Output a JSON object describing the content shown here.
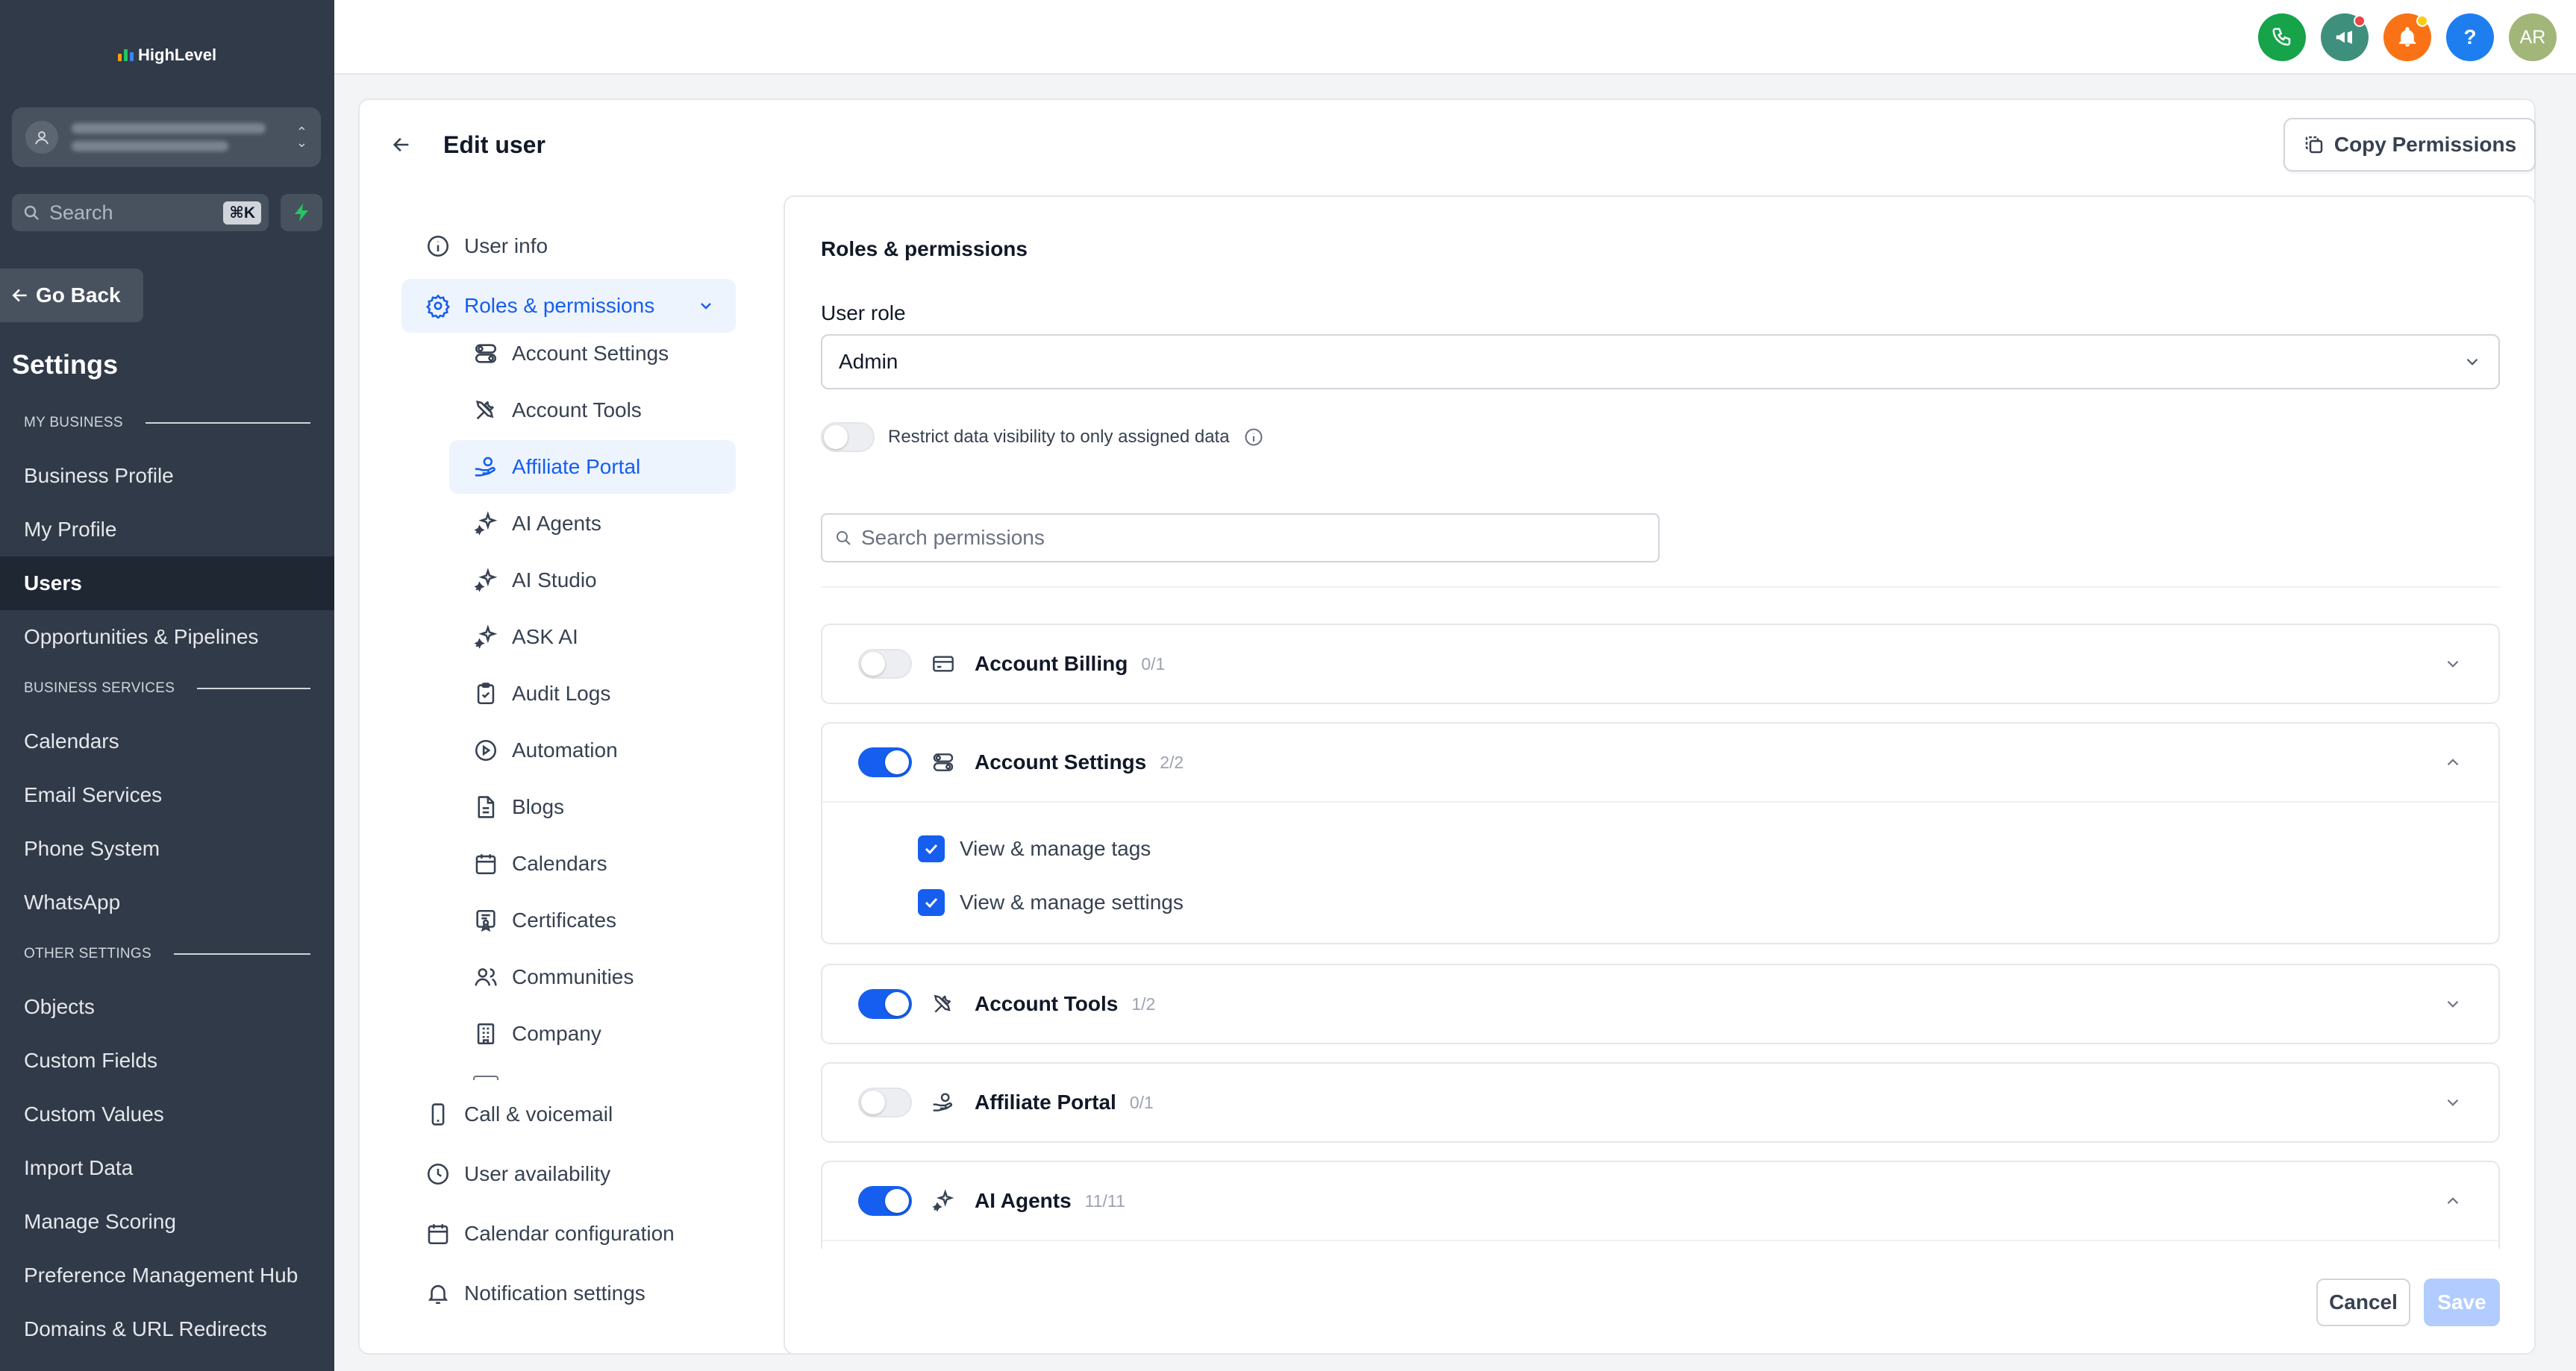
{
  "brand": {
    "name": "HighLevel"
  },
  "sidebar": {
    "search_placeholder": "Search",
    "search_shortcut": "⌘K",
    "go_back": "Go Back",
    "settings_title": "Settings",
    "sections": {
      "my_business": "MY BUSINESS",
      "business_services": "BUSINESS SERVICES",
      "other_settings": "OTHER SETTINGS"
    },
    "items": [
      "Business Profile",
      "My Profile",
      "Users",
      "Opportunities & Pipelines",
      "Calendars",
      "Email Services",
      "Phone System",
      "WhatsApp",
      "Objects",
      "Custom Fields",
      "Custom Values",
      "Import Data",
      "Manage Scoring",
      "Preference Management Hub",
      "Domains & URL Redirects"
    ],
    "active_item": "Users"
  },
  "topbar": {
    "avatar_initials": "AR",
    "help_label": "?",
    "colors": {
      "phone": "#16a34a",
      "announce": "#3f8f7d",
      "notify": "#f97316",
      "help": "#1e7ef0",
      "avatar": "#a3b67a",
      "badge": "#ef4444"
    }
  },
  "page": {
    "title": "Edit user",
    "copy_permissions": "Copy Permissions"
  },
  "subnav": {
    "user_info": "User info",
    "roles_permissions": "Roles & permissions",
    "sub_items": [
      "Account Settings",
      "Account Tools",
      "Affiliate Portal",
      "AI Agents",
      "AI Studio",
      "ASK AI",
      "Audit Logs",
      "Automation",
      "Blogs",
      "Calendars",
      "Certificates",
      "Communities",
      "Company"
    ],
    "active_sub_item": "Affiliate Portal",
    "call_voicemail": "Call & voicemail",
    "user_availability": "User availability",
    "calendar_configuration": "Calendar configuration",
    "notification_settings": "Notification settings"
  },
  "panel": {
    "title": "Roles & permissions",
    "user_role_label": "User role",
    "user_role_value": "Admin",
    "restrict_label": "Restrict data visibility to only assigned data",
    "restrict_enabled": false,
    "search_placeholder": "Search permissions",
    "groups": [
      {
        "name": "Account Billing",
        "count": "0/1",
        "enabled": false,
        "expanded": false
      },
      {
        "name": "Account Settings",
        "count": "2/2",
        "enabled": true,
        "expanded": true,
        "permissions": [
          {
            "label": "View & manage tags",
            "checked": true
          },
          {
            "label": "View & manage settings",
            "checked": true
          }
        ]
      },
      {
        "name": "Account Tools",
        "count": "1/2",
        "enabled": true,
        "expanded": false
      },
      {
        "name": "Affiliate Portal",
        "count": "0/1",
        "enabled": false,
        "expanded": false
      },
      {
        "name": "AI Agents",
        "count": "11/11",
        "enabled": true,
        "expanded": true
      }
    ],
    "cancel": "Cancel",
    "save": "Save"
  },
  "accent_color": "#155eef"
}
